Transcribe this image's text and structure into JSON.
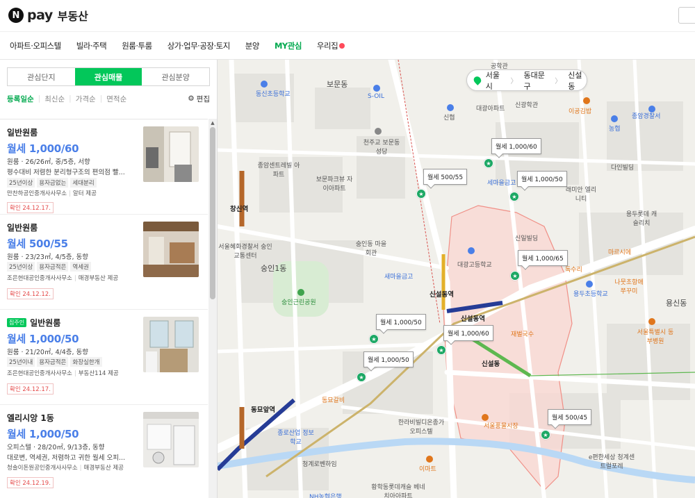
{
  "header": {
    "logo_badge": "N",
    "logo_pay": "pay",
    "title": "부동산"
  },
  "nav": {
    "items": [
      "아파트·오피스텔",
      "빌라·주택",
      "원룸·투룸",
      "상가·업무·공장·토지",
      "분양",
      "MY관심",
      "우리집"
    ],
    "active": "MY관심"
  },
  "sidebar": {
    "tabs": [
      "관심단지",
      "관심매물",
      "관심분양"
    ],
    "active_tab": "관심매물",
    "sort": [
      "등록일순",
      "최신순",
      "가격순",
      "면적순"
    ],
    "active_sort": "등록일순",
    "edit_label": "편집",
    "listings": [
      {
        "tag": "",
        "type": "일반원룸",
        "price": "월세 1,000/60",
        "info": "원룸 · 26/26㎡, 중/5층, 서향",
        "desc": "평수대비 저렴한 분리형구조의 편의점 빨...",
        "chips": [
          "25년이상",
          "용자금없는",
          "세대분리"
        ],
        "agent": "만찬하공인중개사사무소",
        "agent_extra": "알터 제공",
        "date": "확인 24.12.17."
      },
      {
        "tag": "",
        "type": "일반원룸",
        "price": "월세 500/55",
        "info": "원룸 · 23/23㎡, 4/5층, 동향",
        "desc": "",
        "chips": [
          "25년이상",
          "용자금적은",
          "역세권"
        ],
        "agent": "조은현대공인중개사사무소",
        "agent_extra": "매경부동산 제공",
        "date": "확인 24.12.12."
      },
      {
        "tag": "집주인",
        "type": "일반원룸",
        "price": "월세 1,000/50",
        "info": "원룸 · 21/20㎡, 4/4층, 동향",
        "desc": "",
        "chips": [
          "25년이내",
          "용자금적은",
          "화장실한개"
        ],
        "agent": "조은현대공인중개사사무소",
        "agent_extra": "부동산114 제공",
        "date": "확인 24.12.17."
      },
      {
        "tag": "",
        "type": "엘리시앙 1동",
        "price": "월세 1,000/50",
        "info": "오피스텔 · 28/20㎡, 9/13층, 동향",
        "desc": "대로변, 역세권, 저렴하고 귀한 월세 오피...",
        "chips": [],
        "agent": "청솔이돈원공인중개사사무소",
        "agent_extra": "매경부동산 제공",
        "date": "확인 24.12.19."
      }
    ]
  },
  "map": {
    "location": [
      "서울시",
      "동대문구",
      "신설동"
    ],
    "bubbles": [
      "월세 1,000/60",
      "월세 500/55",
      "월세 1,000/50",
      "월세 1,000/65",
      "월세 1,000/50",
      "월세 1,000/60",
      "월세 1,000/50",
      "월세 500/45"
    ],
    "places": {
      "gonghakgwan": "공학관",
      "bomundong": "보문동",
      "dongsin_school": "동신초등학교",
      "soil": "S-OIL",
      "cheonjugyo": "천주교 보문동성당",
      "jongam_apt": "종암센트레빌 아파트",
      "bomun_prugio": "보문파크뷰 자이아파트",
      "changsin": "창신역",
      "sungin_maeul": "숭인동 마을회관",
      "police": "서울혜화경찰서 숭인교통센터",
      "sungin1": "숭인1동",
      "sungin_park": "숭인근린공원",
      "sinseoldong_station": "신설동역",
      "dongmyo": "동묘앞역",
      "sinseoldong_station2": "신설동역",
      "yongsindong": "용신동",
      "seoul_pungmul": "서울풍물시장",
      "sinhyeop": "신협",
      "daegwang_apt": "대광아파트",
      "singwang": "신광학관",
      "igong": "이공김밥",
      "nonghyup": "농협",
      "jongam_bank": "종암경찰서",
      "dain": "다인빌딩",
      "saemaeul": "세마을금고",
      "raemian": "래미안 엘리니티",
      "yongdu_lotte": "용두롯데 캐슬리치",
      "daegwang_high": "대광고등학교",
      "dongdaemun_hosp": "서울특별시 동부병원",
      "jaebeol": "재벌국수",
      "dongmyo_sikdang": "동묘갈비",
      "hanaro": "한라비빌디온종가 오피스텔",
      "jonghap": "종로산업 정보학교",
      "cheonggye": "청계로벤하임",
      "hwanghak": "황학동롯데캐슬 베네치아아파트",
      "emart": "이마트",
      "eseoul": "e편한세상 청계센트럴포레",
      "yongdu_school": "용두초등학교",
      "nh_bank": "NH농협은행",
      "sinseoldong_label": "신설동",
      "doksu": "독수리",
      "sinseol_bldg": "신일빌딩",
      "marble": "마르시에",
      "nadan": "나뭇초항애 쭈꾸미",
      "sungin_bank": "새마을금고",
      "sinseol_bank": "신설동역"
    }
  }
}
